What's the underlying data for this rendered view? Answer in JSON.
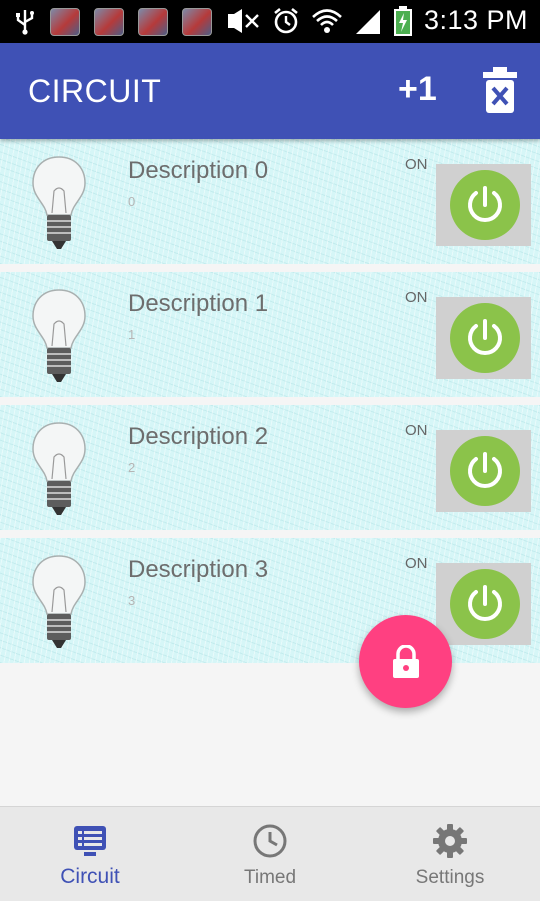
{
  "status_bar": {
    "time": "3:13 PM"
  },
  "app_bar": {
    "title": "CIRCUIT",
    "add_label": "+1"
  },
  "circuits": [
    {
      "description": "Description 0",
      "index": "0",
      "state": "ON"
    },
    {
      "description": "Description 1",
      "index": "1",
      "state": "ON"
    },
    {
      "description": "Description 2",
      "index": "2",
      "state": "ON"
    },
    {
      "description": "Description 3",
      "index": "3",
      "state": "ON"
    }
  ],
  "bottom_nav": [
    {
      "label": "Circuit",
      "icon": "circuit-icon",
      "active": true
    },
    {
      "label": "Timed",
      "icon": "clock-icon",
      "active": false
    },
    {
      "label": "Settings",
      "icon": "gear-icon",
      "active": false
    }
  ],
  "colors": {
    "primary": "#3f51b5",
    "accent": "#ff4081",
    "power": "#8bc34a",
    "card": "#d6f6f7"
  }
}
